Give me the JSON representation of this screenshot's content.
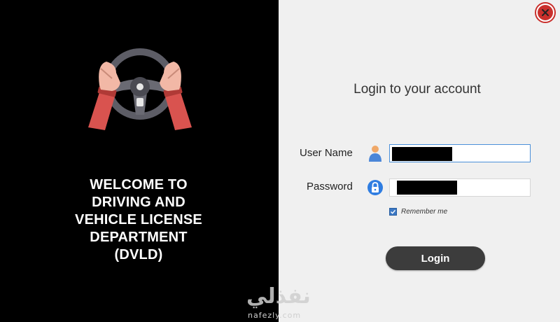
{
  "welcome": {
    "lines": [
      "WELCOME TO",
      "DRIVING AND",
      "VEHICLE LICENSE",
      "DEPARTMENT",
      "(DVLD)"
    ]
  },
  "logo": {
    "icon": "steering-wheel-hands-icon"
  },
  "close": {
    "icon": "close-icon",
    "color": "#c9302c"
  },
  "login": {
    "title": "Login to your account",
    "username_label": "User Name",
    "password_label": "Password",
    "user_icon": "user-icon",
    "lock_icon": "lock-icon",
    "remember_label": "Remember me",
    "remember_checked": true,
    "button_label": "Login"
  },
  "watermark": {
    "arabic": "نفذلي",
    "latin": "nafezly.com"
  },
  "colors": {
    "left_bg": "#000000",
    "right_bg": "#f0f0f0",
    "button_bg": "#3c3c3c",
    "accent": "#4a90d9"
  }
}
